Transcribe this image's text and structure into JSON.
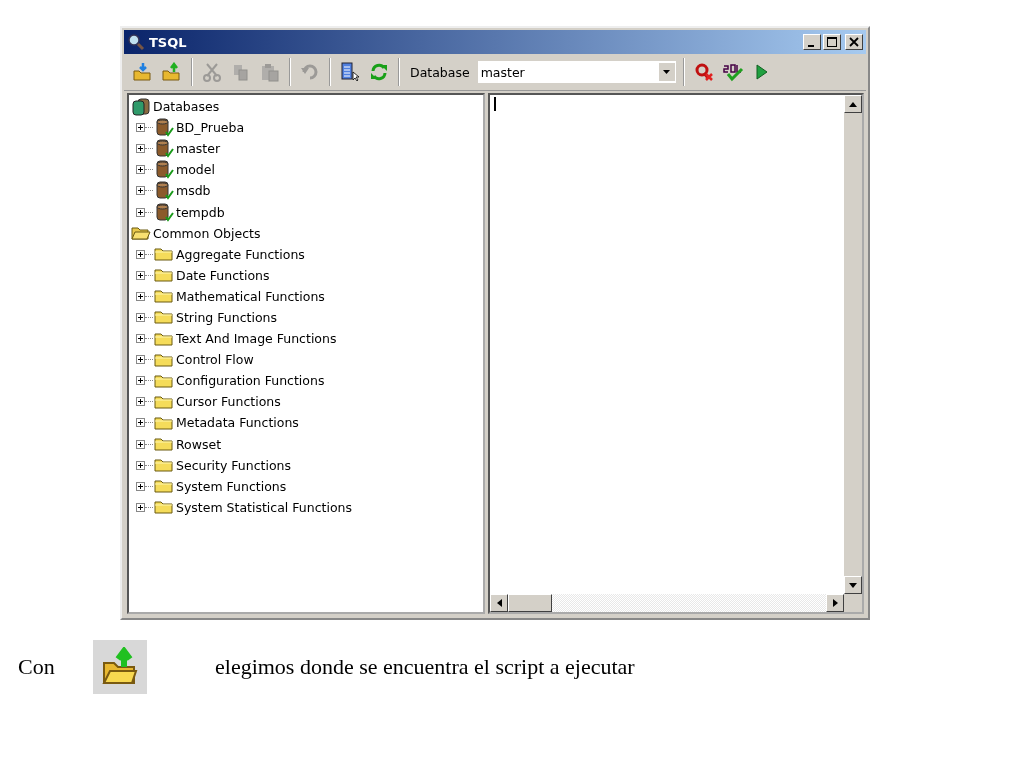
{
  "window": {
    "title": "TSQL"
  },
  "toolbar": {
    "left_buttons": [
      {
        "disabled": false
      },
      {
        "disabled": false
      },
      {
        "disabled": true
      },
      {
        "disabled": true
      },
      {
        "disabled": true
      },
      {
        "disabled": true
      },
      {
        "disabled": false
      },
      {
        "disabled": false
      }
    ],
    "database_label": "Database",
    "database_value": "master",
    "right_buttons": [
      {
        "disabled": false
      },
      {
        "disabled": false
      },
      {
        "disabled": false
      }
    ]
  },
  "tree": [
    {
      "label": "Databases",
      "kind": "databases",
      "children": [
        {
          "label": "BD_Prueba",
          "kind": "database",
          "expanded": false
        },
        {
          "label": "master",
          "kind": "database",
          "expanded": false
        },
        {
          "label": "model",
          "kind": "database",
          "expanded": false
        },
        {
          "label": "msdb",
          "kind": "database",
          "expanded": false
        },
        {
          "label": "tempdb",
          "kind": "database",
          "expanded": false
        }
      ]
    },
    {
      "label": "Common Objects",
      "kind": "folder-open",
      "children": [
        {
          "label": "Aggregate Functions",
          "kind": "folder",
          "expanded": false
        },
        {
          "label": "Date Functions",
          "kind": "folder",
          "expanded": false
        },
        {
          "label": "Mathematical Functions",
          "kind": "folder",
          "expanded": false
        },
        {
          "label": "String Functions",
          "kind": "folder",
          "expanded": false
        },
        {
          "label": "Text And Image Functions",
          "kind": "folder",
          "expanded": false
        },
        {
          "label": "Control Flow",
          "kind": "folder",
          "expanded": false
        },
        {
          "label": "Configuration Functions",
          "kind": "folder",
          "expanded": false
        },
        {
          "label": "Cursor Functions",
          "kind": "folder",
          "expanded": false
        },
        {
          "label": "Metadata Functions",
          "kind": "folder",
          "expanded": false
        },
        {
          "label": "Rowset",
          "kind": "folder",
          "expanded": false
        },
        {
          "label": "Security Functions",
          "kind": "folder",
          "expanded": false
        },
        {
          "label": "System Functions",
          "kind": "folder",
          "expanded": false
        },
        {
          "label": "System Statistical Functions",
          "kind": "folder",
          "expanded": false
        }
      ]
    }
  ],
  "caption": {
    "before": "Con",
    "after": "elegimos donde se encuentra el script a ejecutar"
  }
}
